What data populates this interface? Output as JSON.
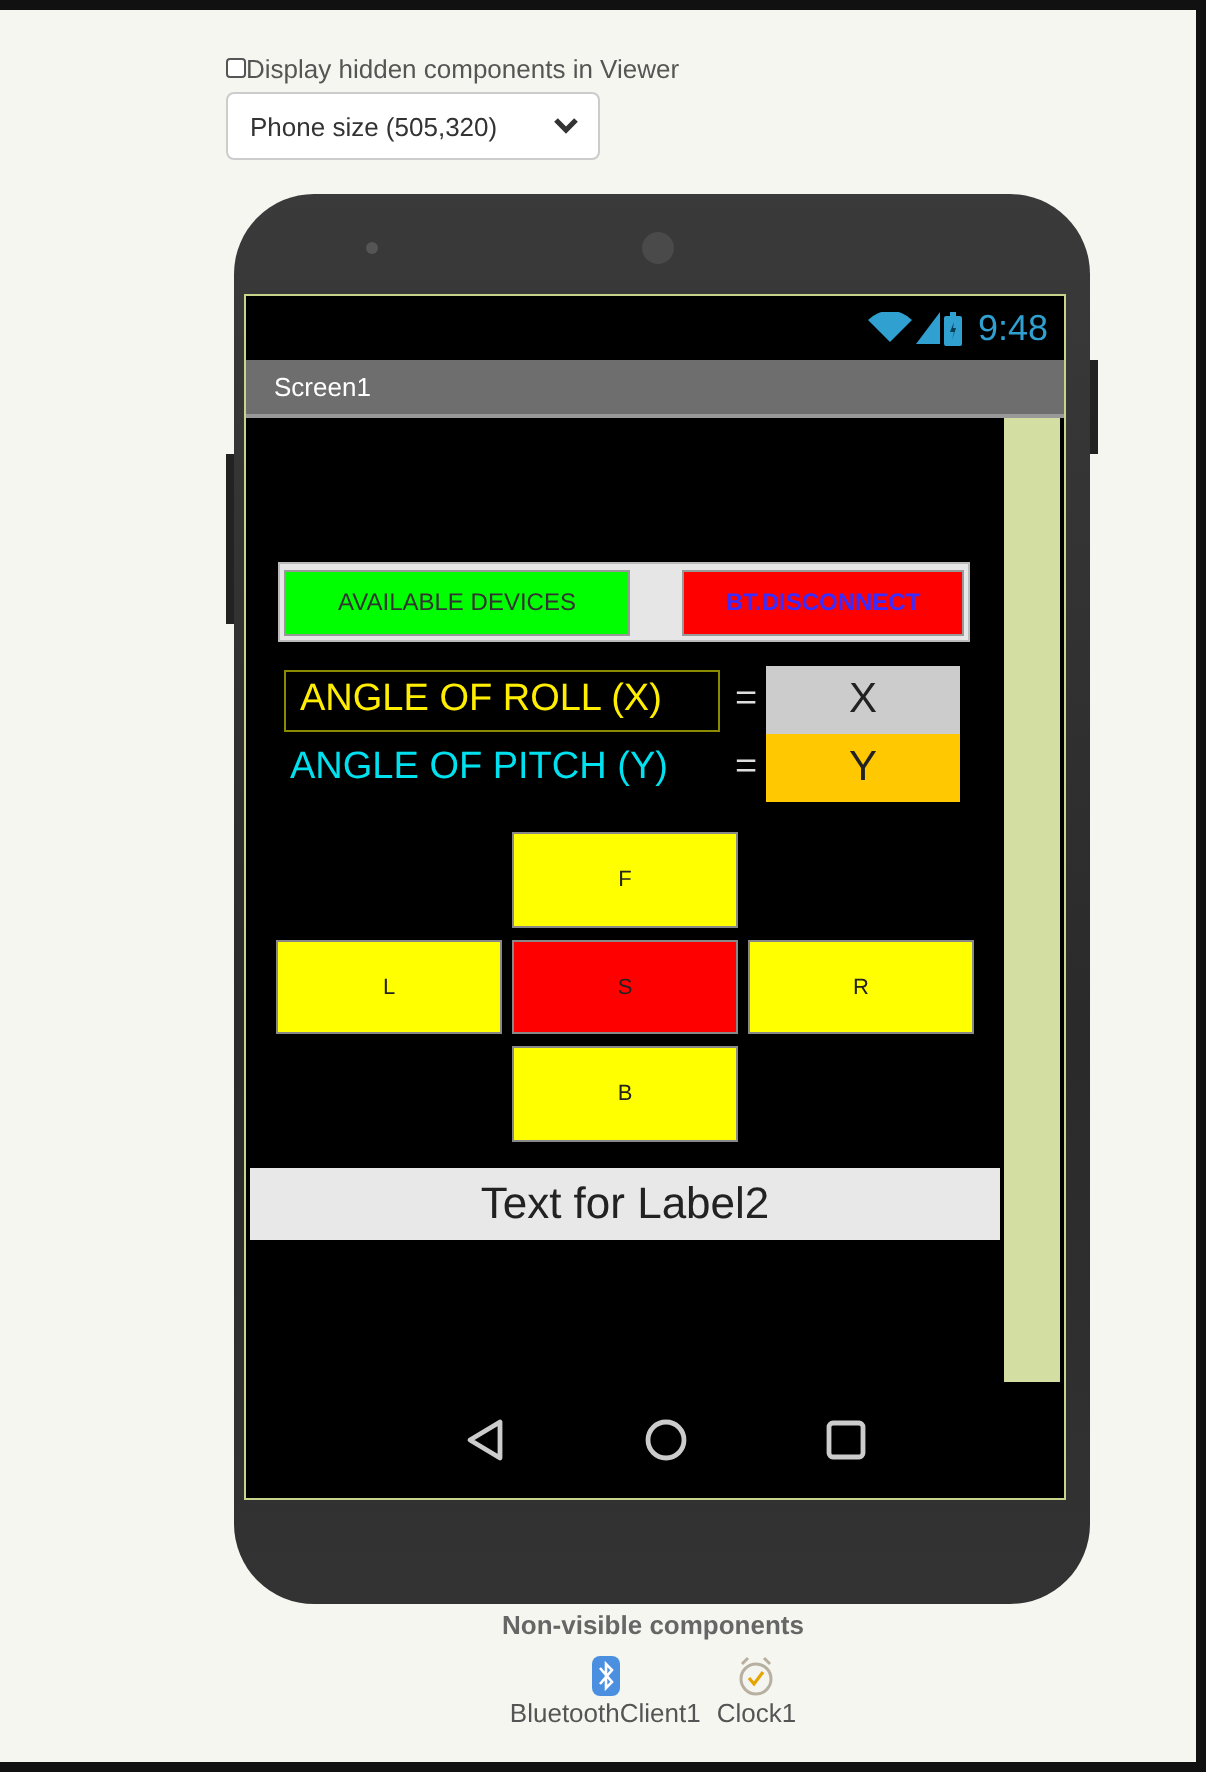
{
  "viewer": {
    "hidden_checkbox": {
      "label": "Display hidden components in Viewer",
      "checked": false
    },
    "size_dropdown": {
      "value": "Phone size (505,320)"
    }
  },
  "phone": {
    "status_bar": {
      "time": "9:48"
    },
    "title": "Screen1",
    "buttons_row": [
      {
        "label": "AVAILABLE DEVICES",
        "color": "#00ff00",
        "kind": "scan"
      },
      {
        "label": "BT.DISCONNECT",
        "color": "#ff0000",
        "kind": "disconnect"
      }
    ],
    "angles": [
      {
        "label": "ANGLE OF ROLL (X)",
        "equals": "=",
        "value": "X",
        "kind": "roll"
      },
      {
        "label": "ANGLE OF PITCH (Y)",
        "equals": "=",
        "value": "Y",
        "kind": "pitch"
      }
    ],
    "pads": [
      {
        "label": "F",
        "kind": "up",
        "color": "#ffff00"
      },
      {
        "label": "L",
        "kind": "left",
        "color": "#ffff00"
      },
      {
        "label": "S",
        "kind": "center",
        "color": "#ff0000"
      },
      {
        "label": "R",
        "kind": "right",
        "color": "#ffff00"
      },
      {
        "label": "B",
        "kind": "down",
        "color": "#ffff00"
      }
    ],
    "label2": "Text for Label2"
  },
  "non_visible": {
    "title": "Non-visible components",
    "items": [
      {
        "label": "BluetoothClient1",
        "kind": "bluetooth"
      },
      {
        "label": "Clock1",
        "kind": "clock"
      }
    ]
  }
}
